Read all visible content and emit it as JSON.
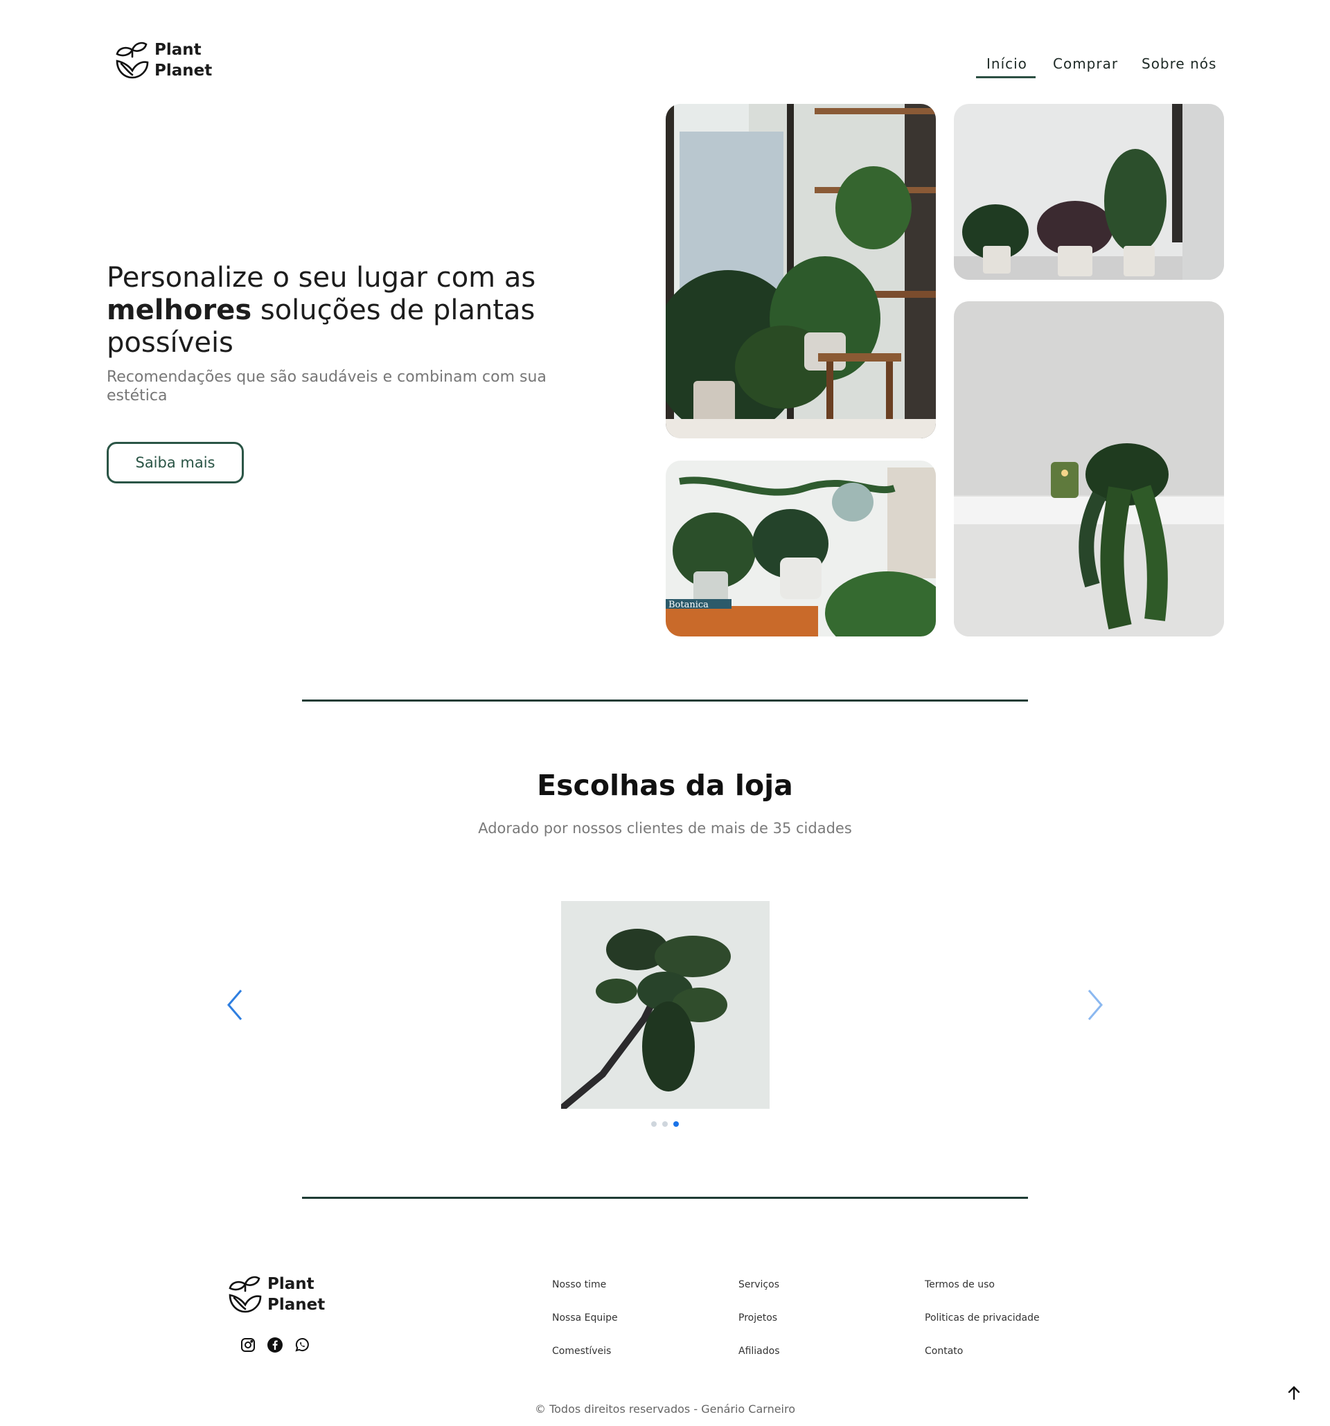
{
  "header": {
    "brand_line1": "Plant",
    "brand_line2": "Planet",
    "nav": [
      {
        "label": "Início",
        "active": true
      },
      {
        "label": "Comprar",
        "active": false
      },
      {
        "label": "Sobre nós",
        "active": false
      }
    ]
  },
  "hero": {
    "title_line1": "Personalize o seu lugar com as",
    "title_bold": "melhores",
    "title_line2_rest": " soluções de plantas",
    "title_line3": "possíveis",
    "subtitle": "Recomendações que são saudáveis e combinam com sua estética",
    "cta_label": "Saiba mais",
    "photo_text": "Botanica"
  },
  "store": {
    "title_bold": "Escolhas",
    "title_rest": " da loja",
    "subtitle": "Adorado por nossos clientes de mais de 35 cidades",
    "carousel": {
      "slide_count": 3,
      "active_slide": 3
    }
  },
  "footer": {
    "brand_line1": "Plant",
    "brand_line2": "Planet",
    "social": [
      "instagram-icon",
      "facebook-icon",
      "whatsapp-icon"
    ],
    "columns": [
      [
        "Nosso time",
        "Nossa Equipe",
        "Comestíveis"
      ],
      [
        "Serviços",
        "Projetos",
        "Afiliados"
      ],
      [
        "Termos de uso",
        "Politicas de privacidade",
        "Contato"
      ]
    ],
    "copyright": "© Todos direitos reservados - Genário Carneiro"
  },
  "colors": {
    "accent": "#2b5546",
    "divider": "#1f3c35",
    "carousel_arrow": "#2f7fe0",
    "dot_active": "#1a73e8",
    "dot_inactive": "#cfd6dd"
  }
}
